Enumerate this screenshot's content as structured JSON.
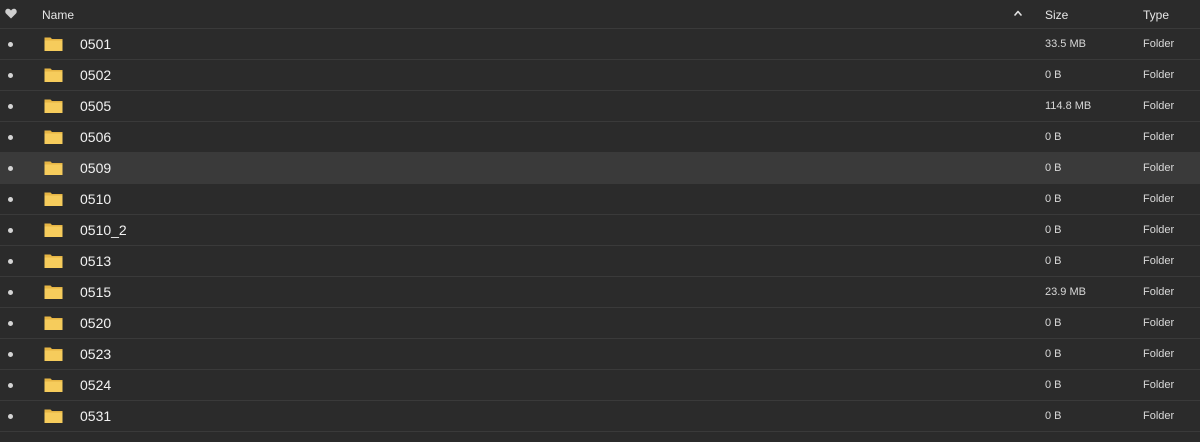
{
  "header": {
    "name_label": "Name",
    "size_label": "Size",
    "type_label": "Type",
    "favorite_icon": "heart-icon",
    "sort_icon": "chevron-up-icon",
    "sort_column": "Name",
    "sort_direction": "ascending"
  },
  "colors": {
    "background": "#2b2b2b",
    "selected_row": "#3a3a3a",
    "divider": "#3a3a3a",
    "folder_yellow": "#f6cc5c",
    "folder_tab": "#e6b544"
  },
  "rows": [
    {
      "name": "0501",
      "size": "33.5 MB",
      "type": "Folder",
      "icon": "folder-icon"
    },
    {
      "name": "0502",
      "size": "0 B",
      "type": "Folder",
      "icon": "folder-icon"
    },
    {
      "name": "0505",
      "size": "114.8 MB",
      "type": "Folder",
      "icon": "folder-icon"
    },
    {
      "name": "0506",
      "size": "0 B",
      "type": "Folder",
      "icon": "folder-icon"
    },
    {
      "name": "0509",
      "size": "0 B",
      "type": "Folder",
      "icon": "folder-icon",
      "selected": true
    },
    {
      "name": "0510",
      "size": "0 B",
      "type": "Folder",
      "icon": "folder-icon"
    },
    {
      "name": "0510_2",
      "size": "0 B",
      "type": "Folder",
      "icon": "folder-icon"
    },
    {
      "name": "0513",
      "size": "0 B",
      "type": "Folder",
      "icon": "folder-icon"
    },
    {
      "name": "0515",
      "size": "23.9 MB",
      "type": "Folder",
      "icon": "folder-icon"
    },
    {
      "name": "0520",
      "size": "0 B",
      "type": "Folder",
      "icon": "folder-icon"
    },
    {
      "name": "0523",
      "size": "0 B",
      "type": "Folder",
      "icon": "folder-icon"
    },
    {
      "name": "0524",
      "size": "0 B",
      "type": "Folder",
      "icon": "folder-icon"
    },
    {
      "name": "0531",
      "size": "0 B",
      "type": "Folder",
      "icon": "folder-icon"
    }
  ]
}
